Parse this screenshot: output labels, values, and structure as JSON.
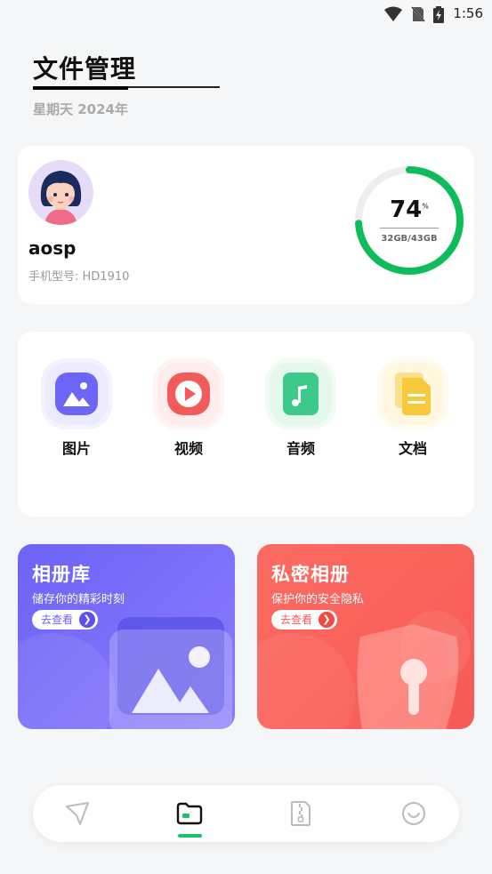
{
  "status_bar": {
    "time": "1:56",
    "icons": [
      "wifi-icon",
      "no-sim-icon",
      "battery-charging-icon"
    ]
  },
  "header": {
    "title": "文件管理",
    "subtitle": "星期天  2024年"
  },
  "profile": {
    "username": "aosp",
    "model": "手机型号: HD1910",
    "storage_percent": 74,
    "storage_percent_symbol": "%",
    "storage_text": "32GB/43GB",
    "gauge_color": "#0ebd5a"
  },
  "categories": [
    {
      "label": "图片",
      "icon": "image-icon",
      "color": "#6b66f6"
    },
    {
      "label": "视频",
      "icon": "play-icon",
      "color": "#f55a5a"
    },
    {
      "label": "音频",
      "icon": "music-file-icon",
      "color": "#3cc98a"
    },
    {
      "label": "文档",
      "icon": "document-icon",
      "color": "#f8c93c"
    }
  ],
  "promos": [
    {
      "title": "相册库",
      "subtitle": "储存你的精彩时刻",
      "button": "去查看",
      "color": "#6b5ff6"
    },
    {
      "title": "私密相册",
      "subtitle": "保护你的安全隐私",
      "button": "去查看",
      "color": "#f9605a"
    }
  ],
  "bottom_nav": {
    "items": [
      "send-icon",
      "folder-icon",
      "zip-file-icon",
      "profile-icon"
    ],
    "active": "folder-icon",
    "accent": "#14c56a"
  }
}
